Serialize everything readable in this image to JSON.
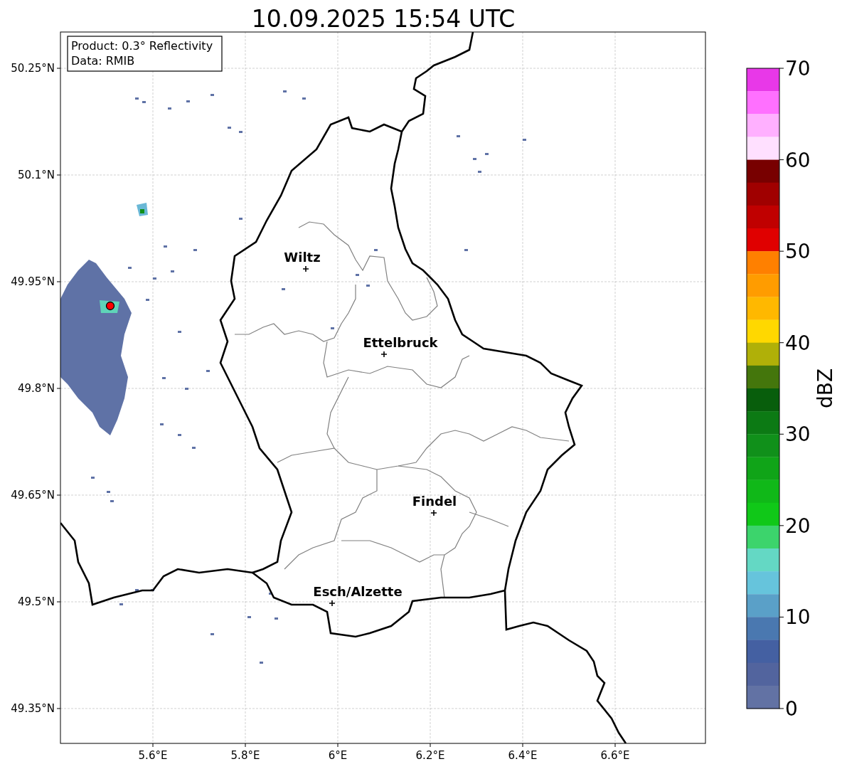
{
  "title": "10.09.2025 15:54 UTC",
  "info_box": [
    "Product: 0.3° Reflectivity",
    "Data: RMIB"
  ],
  "map": {
    "yticks": [
      "50.25°N",
      "50.1°N",
      "49.95°N",
      "49.8°N",
      "49.65°N",
      "49.5°N",
      "49.35°N"
    ],
    "xticks": [
      "5.6°E",
      "5.8°E",
      "6°E",
      "6.2°E",
      "6.4°E",
      "6.6°E"
    ],
    "cities": [
      {
        "name": "Wiltz"
      },
      {
        "name": "Ettelbruck"
      },
      {
        "name": "Findel"
      },
      {
        "name": "Esch/Alzette"
      }
    ]
  },
  "colorbar": {
    "label": "dBZ",
    "ticks": [
      "70",
      "60",
      "50",
      "40",
      "30",
      "20",
      "10",
      "0"
    ],
    "bands": [
      {
        "color": "#e838e8"
      },
      {
        "color": "#ff70ff"
      },
      {
        "color": "#ffb0ff"
      },
      {
        "color": "#ffe0ff"
      },
      {
        "color": "#780000"
      },
      {
        "color": "#a00000"
      },
      {
        "color": "#c00000"
      },
      {
        "color": "#e00000"
      },
      {
        "color": "#ff8000"
      },
      {
        "color": "#ff9c00"
      },
      {
        "color": "#ffb800"
      },
      {
        "color": "#ffd800"
      },
      {
        "color": "#b0b008"
      },
      {
        "color": "#44760c"
      },
      {
        "color": "#085e0c"
      },
      {
        "color": "#0c7a14"
      },
      {
        "color": "#10901a"
      },
      {
        "color": "#10a418"
      },
      {
        "color": "#10b818"
      },
      {
        "color": "#10c818"
      },
      {
        "color": "#3cd46c"
      },
      {
        "color": "#64d8c4"
      },
      {
        "color": "#66c4dc"
      },
      {
        "color": "#5aa0c8"
      },
      {
        "color": "#4a78b0"
      },
      {
        "color": "#4460a2"
      },
      {
        "color": "#52649e"
      },
      {
        "color": "#6272a4"
      }
    ]
  }
}
